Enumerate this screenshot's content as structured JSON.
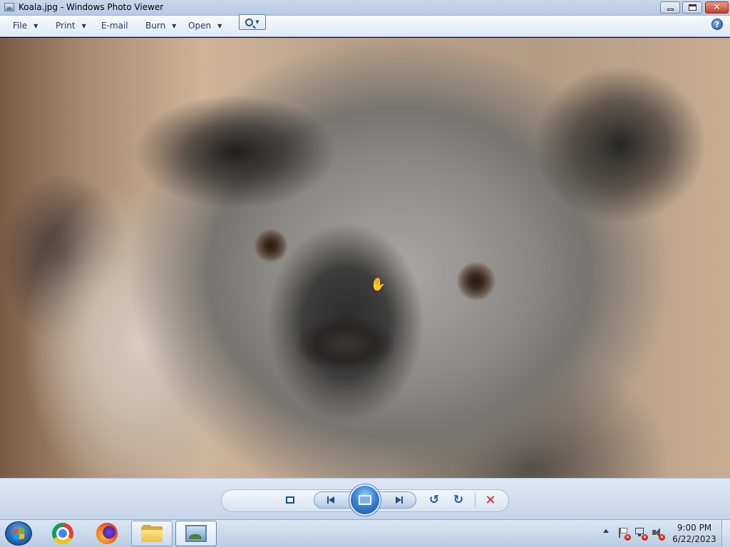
{
  "window": {
    "title": "Koala.jpg - Windows Photo Viewer",
    "minimize_icon": "minimize-icon",
    "maximize_icon": "restore-icon",
    "close_icon": "close-icon",
    "close_color": "#c3402a"
  },
  "menu": {
    "items": [
      {
        "label": "File",
        "has_dropdown": true
      },
      {
        "label": "Print",
        "has_dropdown": true
      },
      {
        "label": "E-mail",
        "has_dropdown": false
      },
      {
        "label": "Burn",
        "has_dropdown": true
      },
      {
        "label": "Open",
        "has_dropdown": true
      }
    ],
    "help_label": "?"
  },
  "photo": {
    "subject": "koala",
    "cursor_icon": "hand-icon"
  },
  "controls": {
    "zoom_icon": "zoom-icon",
    "actual_size_icon": "actual-size-icon",
    "previous_icon": "previous-icon",
    "slideshow_icon": "slideshow-icon",
    "next_icon": "next-icon",
    "rotate_ccw_icon": "rotate-counterclockwise-icon",
    "rotate_cw_icon": "rotate-clockwise-icon",
    "delete_icon": "delete-icon",
    "delete_color": "#d0211b"
  },
  "taskbar": {
    "start_icon": "windows-start-icon",
    "pinned": [
      "chrome-icon",
      "firefox-icon",
      "file-explorer-icon",
      "photo-viewer-icon"
    ],
    "tray_icons": [
      "show-hidden-icons-arrow",
      "action-center-flag-icon",
      "network-icon",
      "volume-muted-icon"
    ],
    "clock": {
      "time": "9:00 PM",
      "date": "6/22/2023"
    }
  }
}
